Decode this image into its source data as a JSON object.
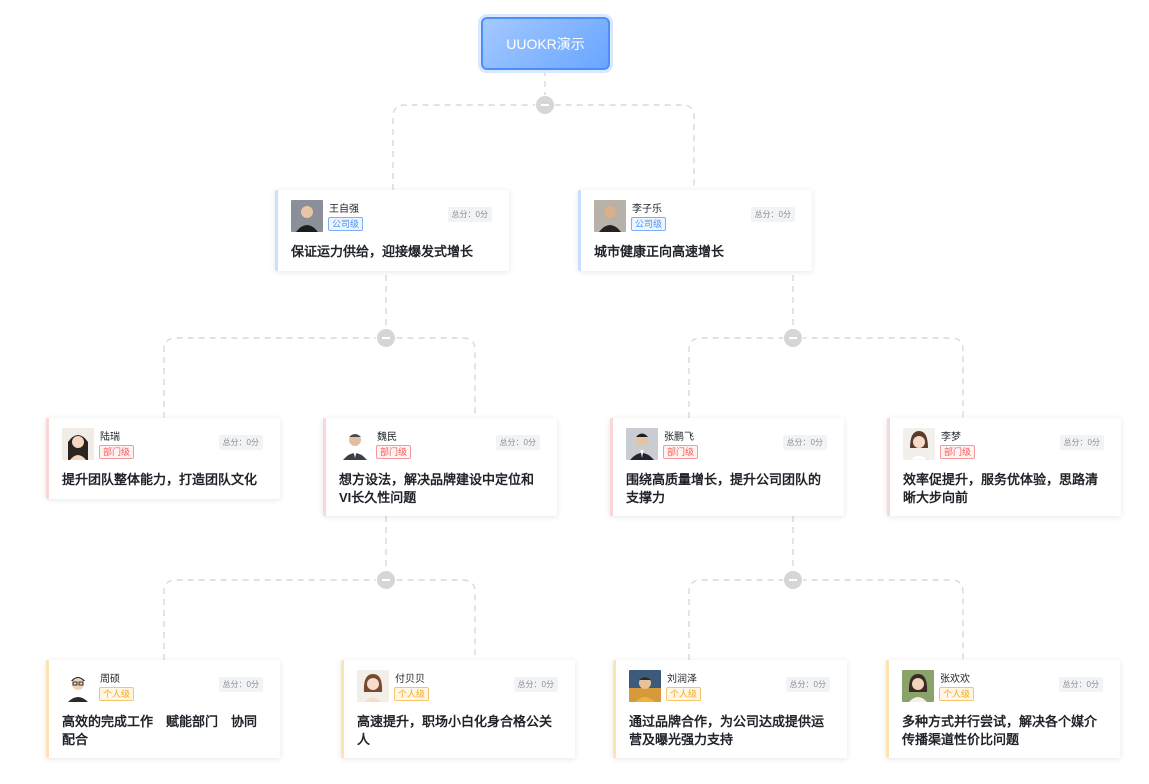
{
  "root": {
    "title": "UUOKR演示"
  },
  "score_label": "总分：0分",
  "levels": {
    "company": "公司级",
    "dept": "部门级",
    "personal": "个人级"
  },
  "colors": {
    "root_gradient_start": "#a4c9ff",
    "root_gradient_end": "#69a5ff",
    "company_accent": "#4c8ff5",
    "dept_accent": "#f05b5b",
    "personal_accent": "#f5a623",
    "connector": "#d9d9d9"
  },
  "nodes": [
    {
      "id": "n1",
      "owner": "王自强",
      "level": "公司级",
      "score": "总分：0分",
      "objective": "保证运力供给，迎接爆发式增长"
    },
    {
      "id": "n2",
      "owner": "李子乐",
      "level": "公司级",
      "score": "总分：0分",
      "objective": "城市健康正向高速增长"
    },
    {
      "id": "n3",
      "owner": "陆瑞",
      "level": "部门级",
      "score": "总分：0分",
      "objective": "提升团队整体能力，打造团队文化"
    },
    {
      "id": "n4",
      "owner": "魏民",
      "level": "部门级",
      "score": "总分：0分",
      "objective": "想方设法，解决品牌建设中定位和VI长久性问题"
    },
    {
      "id": "n5",
      "owner": "张鹏飞",
      "level": "部门级",
      "score": "总分：0分",
      "objective": "围绕高质量增长，提升公司团队的支撑力"
    },
    {
      "id": "n6",
      "owner": "李梦",
      "level": "部门级",
      "score": "总分：0分",
      "objective": "效率促提升，服务优体验，思路清晰大步向前"
    },
    {
      "id": "n7",
      "owner": "周硕",
      "level": "个人级",
      "score": "总分：0分",
      "objective": "高效的完成工作　赋能部门　协同配合"
    },
    {
      "id": "n8",
      "owner": "付贝贝",
      "level": "个人级",
      "score": "总分：0分",
      "objective": "高速提升，职场小白化身合格公关人"
    },
    {
      "id": "n9",
      "owner": "刘润泽",
      "level": "个人级",
      "score": "总分：0分",
      "objective": "通过品牌合作，为公司达成提供运营及曝光强力支持"
    },
    {
      "id": "n10",
      "owner": "张欢欢",
      "level": "个人级",
      "score": "总分：0分",
      "objective": "多种方式并行尝试，解决各个媒介传播渠道性价比问题"
    }
  ],
  "icons": {
    "collapse": "minus-icon",
    "avatar": "user-avatar-icon"
  }
}
